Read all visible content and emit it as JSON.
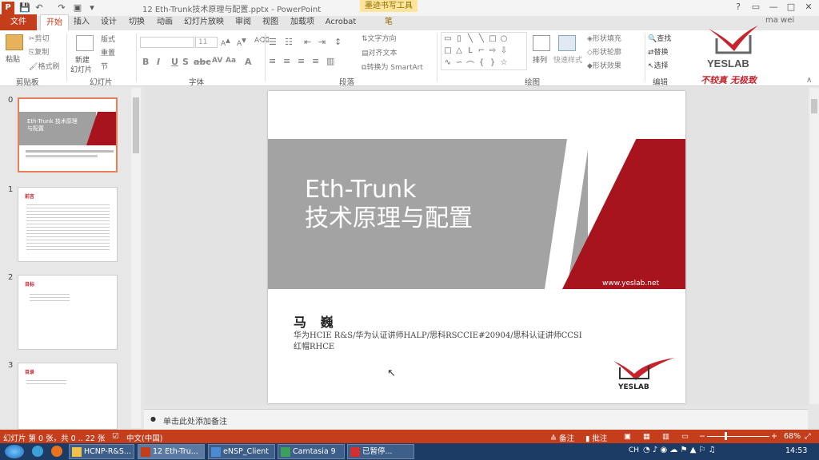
{
  "titlebar": {
    "app_icon": "P",
    "title": "12 Eth-Trunk技术原理与配置.pptx - PowerPoint",
    "context_tab": "墨迹书写工具",
    "context_tab_sub": "笔",
    "user": "ma wei",
    "controls": [
      "?",
      "▭",
      "—",
      "□",
      "✕"
    ]
  },
  "tabs": [
    "文件",
    "开始",
    "插入",
    "设计",
    "切换",
    "动画",
    "幻灯片放映",
    "审阅",
    "视图",
    "加载项",
    "Acrobat"
  ],
  "ribbon": {
    "paste": "粘贴",
    "cut": "剪切",
    "copy": "复制",
    "format_painter": "格式刷",
    "new_slide": "新建",
    "new_slide2": "幻灯片",
    "layout": "版式",
    "reset": "重置",
    "section": "节",
    "font_size": "11",
    "text_direction": "文字方向",
    "align_text": "对齐文本",
    "smartart": "转换为 SmartArt",
    "arrange": "排列",
    "quick_styles": "快速样式",
    "shape_fill": "形状填充",
    "shape_outline": "形状轮廓",
    "shape_effects": "形状效果",
    "find": "查找",
    "replace": "替换",
    "select": "选择",
    "groups": [
      "剪贴板",
      "幻灯片",
      "字体",
      "段落",
      "绘图",
      "编辑"
    ]
  },
  "logo": {
    "name": "YESLAB",
    "slogan": "不较真  无极致"
  },
  "thumbnails": [
    {
      "num": "0",
      "title": "Eth-Trunk 技术原理与配置"
    },
    {
      "num": "1",
      "title": "前言"
    },
    {
      "num": "2",
      "title": "目标"
    },
    {
      "num": "3",
      "title": "目录"
    }
  ],
  "slide": {
    "title_line1": "Eth-Trunk",
    "title_line2": "技术原理与配置",
    "url": "www.yeslab.net",
    "author": "马 巍",
    "cred_line1": "华为HCIE R&S/华为认证讲师HALP/思科RSCCIE#20904/思科认证讲师CCSI",
    "cred_line2": "红帽RHCE",
    "logo": "YESLAB"
  },
  "notes": {
    "placeholder": "单击此处添加备注"
  },
  "status": {
    "slide_info": "幻灯片 第 0 张，共 0 .. 22 张",
    "language": "中文(中国)",
    "notes": "备注",
    "comments": "批注",
    "zoom": "68%"
  },
  "taskbar": {
    "items": [
      "HCNP-R&S...",
      "12 Eth-Tru...",
      "eNSP_Client",
      "Camtasia 9",
      "已暂停..."
    ],
    "clock": "14:53",
    "lang": "CH"
  }
}
